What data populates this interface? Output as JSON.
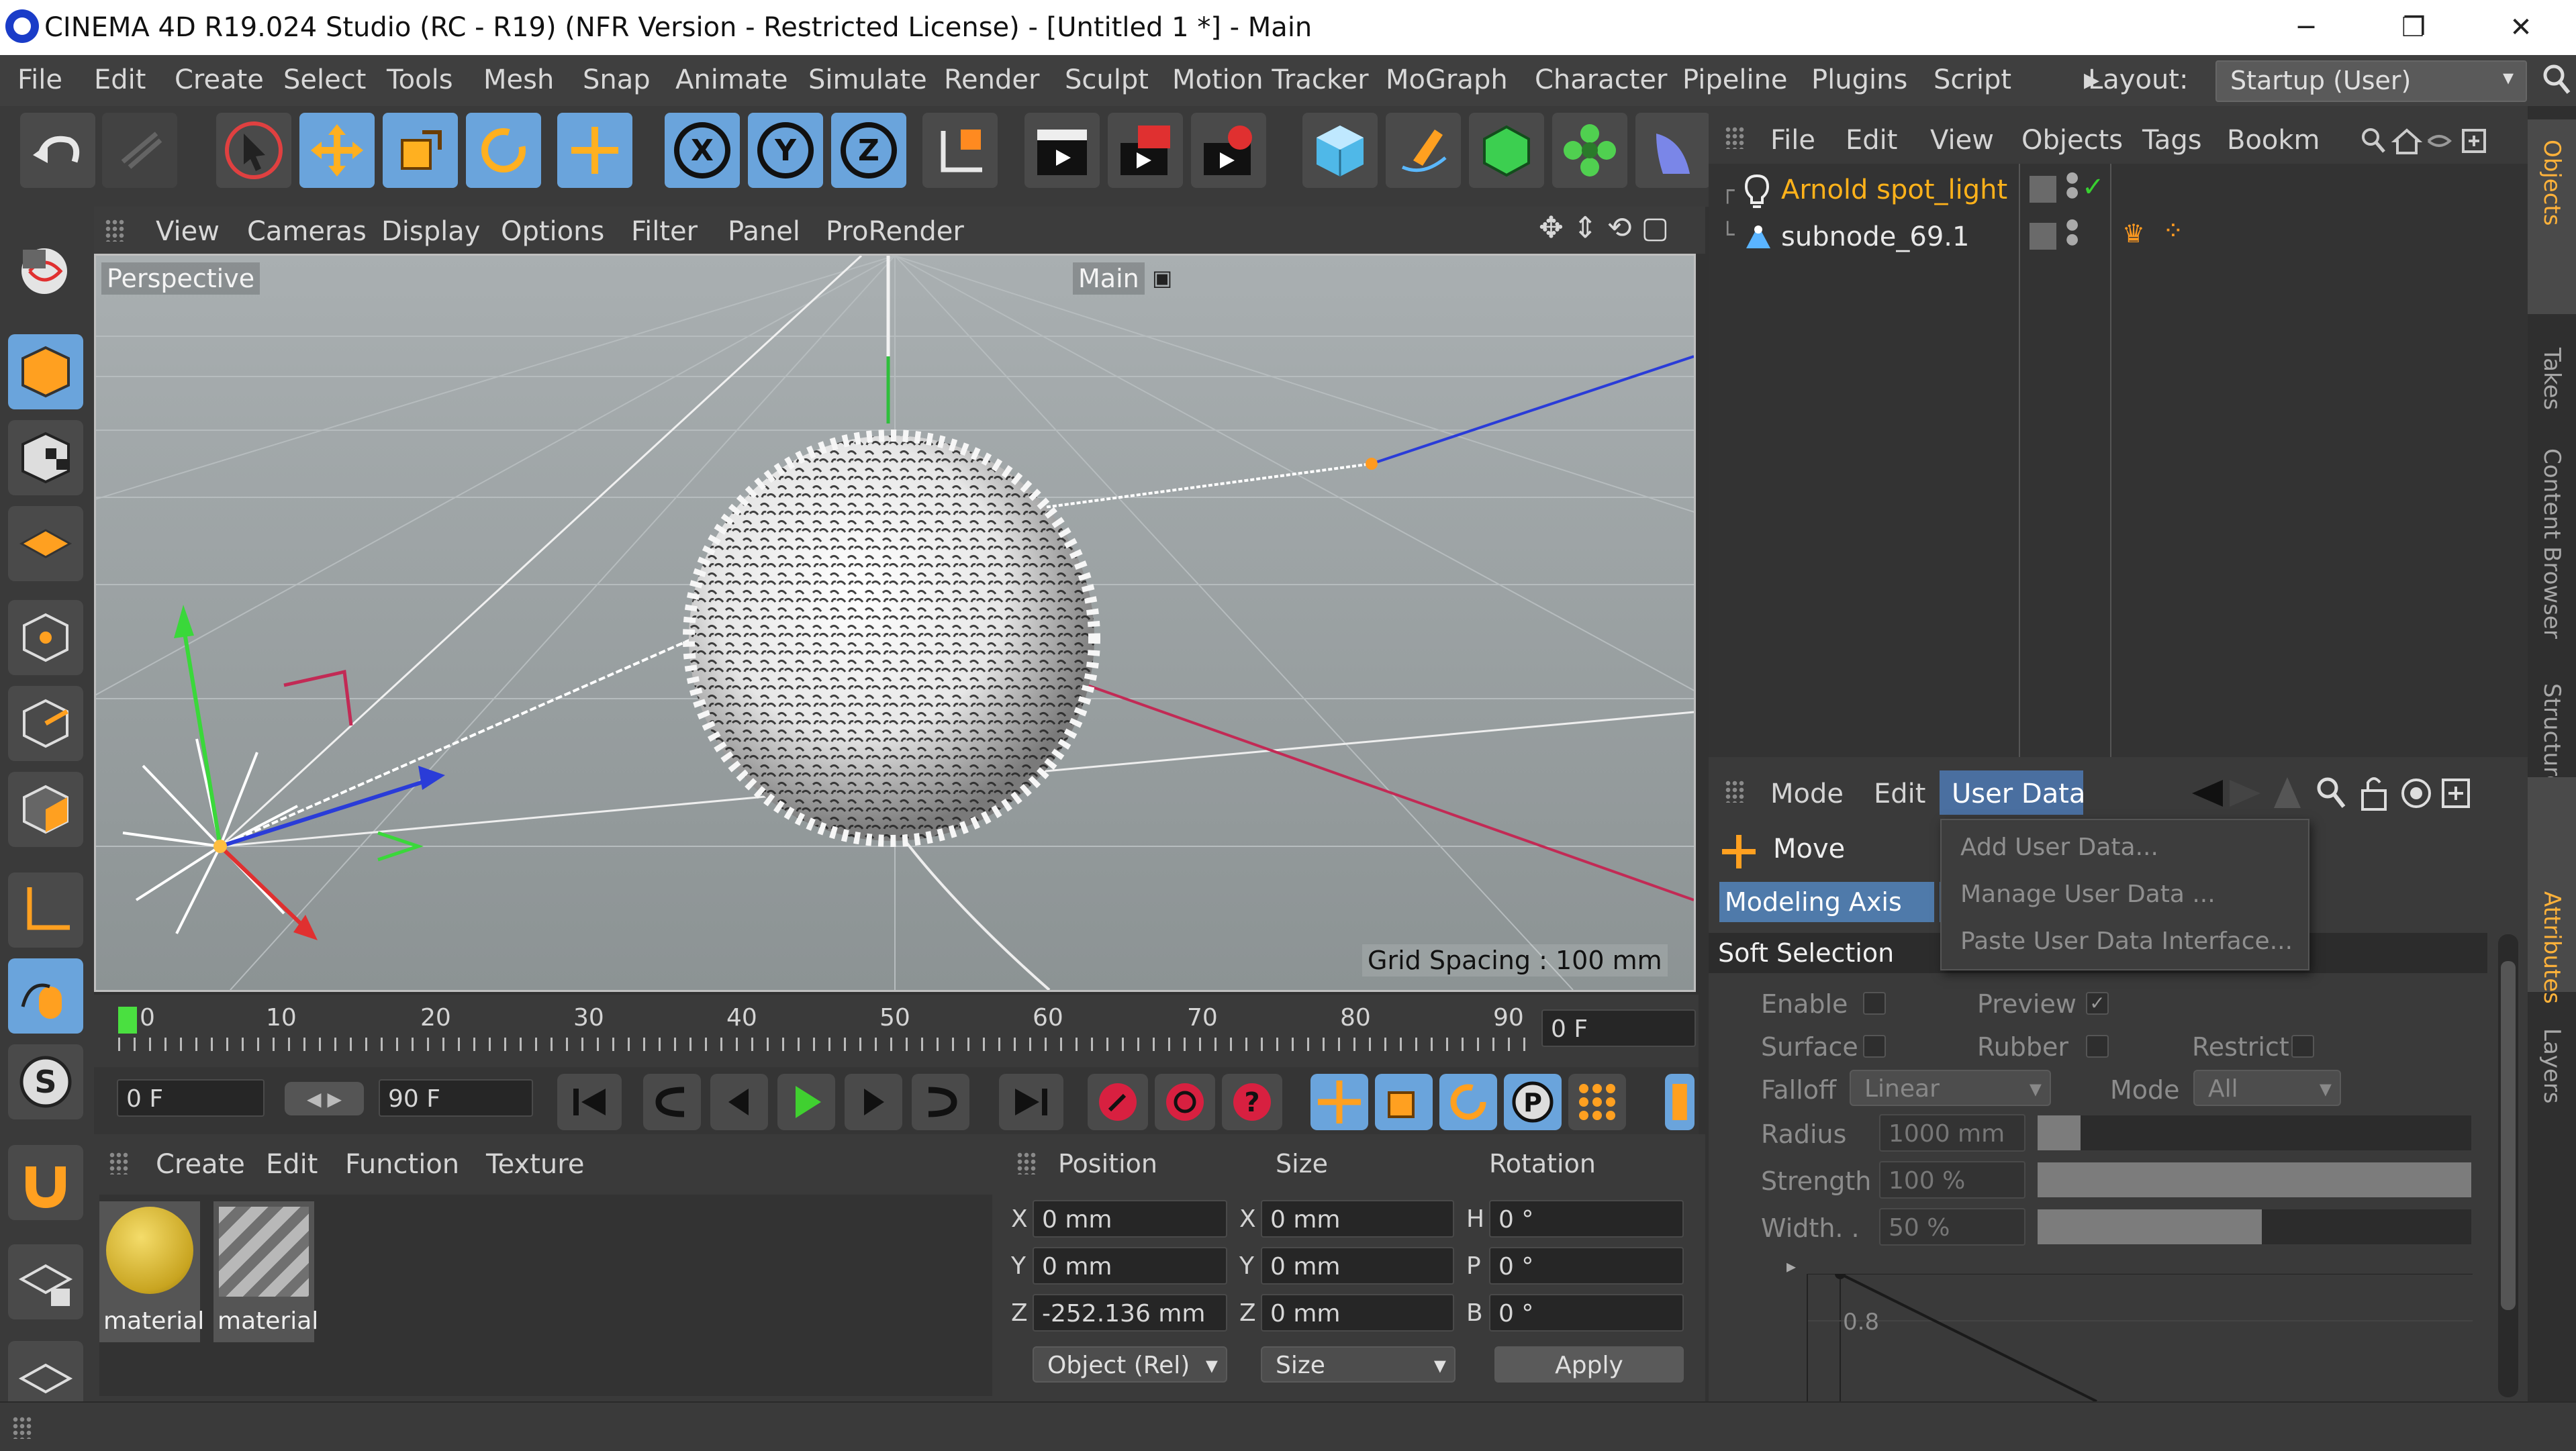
{
  "window": {
    "title": "CINEMA 4D R19.024 Studio (RC - R19) (NFR Version - Restricted License) - [Untitled 1 *] - Main",
    "minimize": "─",
    "restore": "❐",
    "close": "✕"
  },
  "menubar": {
    "items": [
      "File",
      "Edit",
      "Create",
      "Select",
      "Tools",
      "Mesh",
      "Snap",
      "Animate",
      "Simulate",
      "Render",
      "Sculpt",
      "Motion Tracker",
      "MoGraph",
      "Character",
      "Pipeline",
      "Plugins",
      "Script"
    ],
    "layout_label": "Layout:",
    "layout_value": "Startup (User)"
  },
  "viewport": {
    "menu": [
      "View",
      "Cameras",
      "Display",
      "Options",
      "Filter",
      "Panel",
      "ProRender"
    ],
    "view_name": "Perspective",
    "camera_name": "Main",
    "grid_spacing": "Grid Spacing : 100 mm"
  },
  "timeline": {
    "ticks": [
      "0",
      "10",
      "20",
      "30",
      "40",
      "50",
      "60",
      "70",
      "80",
      "90"
    ],
    "current_frame": "0 F",
    "start_frame": "0 F",
    "end_frame": "90 F"
  },
  "materials": {
    "menu": [
      "Create",
      "Edit",
      "Function",
      "Texture"
    ],
    "items": [
      "material",
      "material"
    ]
  },
  "coordinates": {
    "headers": [
      "Position",
      "Size",
      "Rotation"
    ],
    "position": {
      "X": "0 mm",
      "Y": "0 mm",
      "Z": "-252.136 mm"
    },
    "size": {
      "X": "0 mm",
      "Y": "0 mm",
      "Z": "0 mm"
    },
    "rotation": {
      "H": "0 °",
      "P": "0 °",
      "B": "0 °"
    },
    "mode_select": "Object (Rel)",
    "size_select": "Size",
    "apply": "Apply"
  },
  "objects": {
    "menu": [
      "File",
      "Edit",
      "View",
      "Objects",
      "Tags",
      "Bookm"
    ],
    "rows": [
      {
        "name": "Arnold spot_light"
      },
      {
        "name": "subnode_69.1"
      }
    ]
  },
  "attributes": {
    "menu": [
      "Mode",
      "Edit",
      "User Data"
    ],
    "object_label": "Move",
    "tab_modeling_axis": "Modeling Axis",
    "section": "Soft Selection",
    "enable": "Enable",
    "preview": "Preview",
    "surface": "Surface",
    "rubber": "Rubber",
    "restrict": "Restrict",
    "falloff": "Falloff",
    "falloff_value": "Linear",
    "mode": "Mode",
    "mode_value": "All",
    "radius": "Radius",
    "radius_value": "1000 mm",
    "strength": "Strength",
    "strength_value": "100 %",
    "width": "Width. .",
    "width_value": "50 %",
    "graph_tick": "0.8"
  },
  "userdata_menu": [
    "Add User Data...",
    "Manage User Data ...",
    "Paste User Data Interface..."
  ],
  "right_tabs": [
    "Objects",
    "Takes",
    "Content Browser",
    "Structure",
    "Attributes",
    "Layers"
  ]
}
